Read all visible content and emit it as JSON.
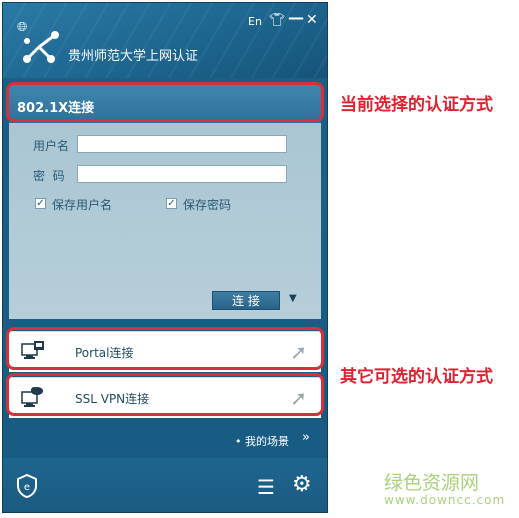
{
  "window": {
    "title": "贵州师范大学上网认证",
    "lang_label": "En",
    "minimize_label": "—",
    "close_label": "✕"
  },
  "current_method": {
    "label": "802.1X连接"
  },
  "login": {
    "username_label": "用户名",
    "password_label": "密  码",
    "username_value": "",
    "password_value": "",
    "save_username_label": "保存用户名",
    "save_password_label": "保存密码",
    "save_username_checked": true,
    "save_password_checked": true,
    "connect_label": "连 接"
  },
  "alternatives": [
    {
      "label": "Portal连接"
    },
    {
      "label": "SSL VPN连接"
    }
  ],
  "scene_link": {
    "label": "我的场景",
    "arrow": "»"
  },
  "annotations": {
    "current": "当前选择的认证方式",
    "others": "其它可选的认证方式"
  },
  "watermark": {
    "name": "绿色资源网",
    "url": "www.downcc.com"
  },
  "icons": [
    "globe-icon",
    "app-logo-icon",
    "shirt-icon",
    "minimize-icon",
    "close-icon",
    "dropdown-caret-icon",
    "portal-icon",
    "vpn-icon",
    "open-arrow-icon",
    "e-shield-icon",
    "list-icon",
    "gear-icon"
  ],
  "colors": {
    "window_blue": "#1d5d83",
    "panel": "#b6ced9",
    "annotation_red": "#e0212f",
    "watermark_green": "#a9d27c"
  }
}
